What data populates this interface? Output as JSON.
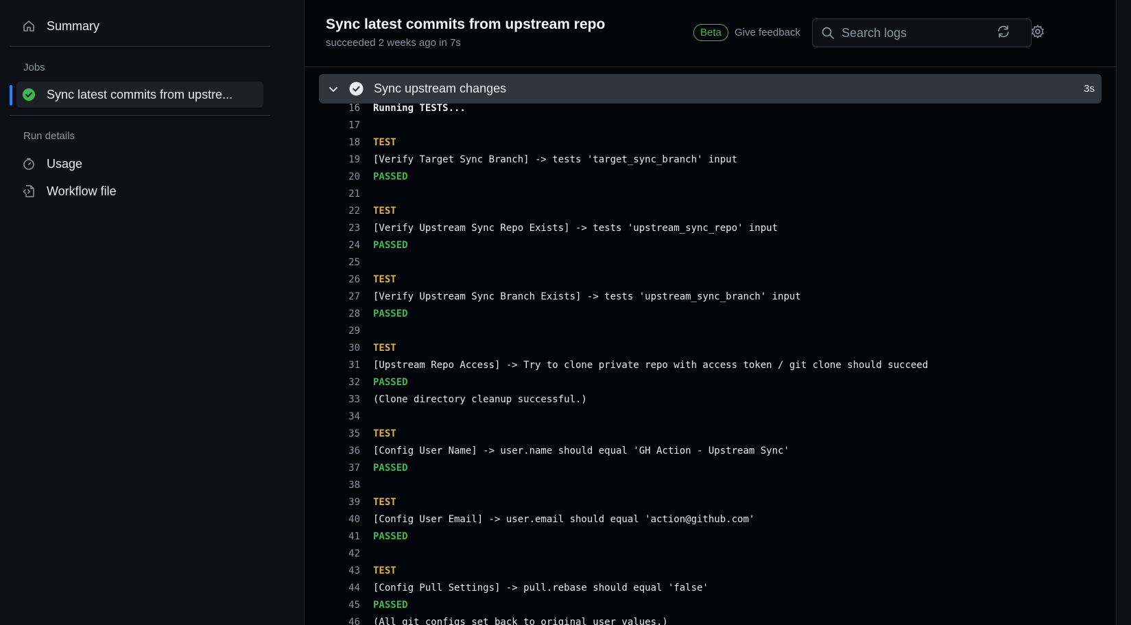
{
  "sidebar": {
    "summary_label": "Summary",
    "jobs_title": "Jobs",
    "job_label": "Sync latest commits from upstre...",
    "run_details_title": "Run details",
    "usage_label": "Usage",
    "workflow_label": "Workflow file"
  },
  "header": {
    "title": "Sync latest commits from upstream repo",
    "subtitle": "succeeded 2 weeks ago in 7s",
    "beta_label": "Beta",
    "feedback_label": "Give feedback",
    "search_placeholder": "Search logs"
  },
  "step": {
    "title": "Sync upstream changes",
    "duration": "3s"
  },
  "log_lines": [
    {
      "n": "16",
      "t": "Running TESTS...",
      "k": "info"
    },
    {
      "n": "17",
      "t": "",
      "k": ""
    },
    {
      "n": "18",
      "t": "TEST",
      "k": "test"
    },
    {
      "n": "19",
      "t": "[Verify Target Sync Branch] -> tests 'target_sync_branch' input",
      "k": ""
    },
    {
      "n": "20",
      "t": "PASSED",
      "k": "passed"
    },
    {
      "n": "21",
      "t": "",
      "k": ""
    },
    {
      "n": "22",
      "t": "TEST",
      "k": "test"
    },
    {
      "n": "23",
      "t": "[Verify Upstream Sync Repo Exists] -> tests 'upstream_sync_repo' input",
      "k": ""
    },
    {
      "n": "24",
      "t": "PASSED",
      "k": "passed"
    },
    {
      "n": "25",
      "t": "",
      "k": ""
    },
    {
      "n": "26",
      "t": "TEST",
      "k": "test"
    },
    {
      "n": "27",
      "t": "[Verify Upstream Sync Branch Exists] -> tests 'upstream_sync_branch' input",
      "k": ""
    },
    {
      "n": "28",
      "t": "PASSED",
      "k": "passed"
    },
    {
      "n": "29",
      "t": "",
      "k": ""
    },
    {
      "n": "30",
      "t": "TEST",
      "k": "test"
    },
    {
      "n": "31",
      "t": "[Upstream Repo Access] -> Try to clone private repo with access token / git clone should succeed",
      "k": ""
    },
    {
      "n": "32",
      "t": "PASSED",
      "k": "passed"
    },
    {
      "n": "33",
      "t": "(Clone directory cleanup successful.)",
      "k": ""
    },
    {
      "n": "34",
      "t": "",
      "k": ""
    },
    {
      "n": "35",
      "t": "TEST",
      "k": "test"
    },
    {
      "n": "36",
      "t": "[Config User Name] -> user.name should equal 'GH Action - Upstream Sync'",
      "k": ""
    },
    {
      "n": "37",
      "t": "PASSED",
      "k": "passed"
    },
    {
      "n": "38",
      "t": "",
      "k": ""
    },
    {
      "n": "39",
      "t": "TEST",
      "k": "test"
    },
    {
      "n": "40",
      "t": "[Config User Email] -> user.email should equal 'action@github.com'",
      "k": ""
    },
    {
      "n": "41",
      "t": "PASSED",
      "k": "passed"
    },
    {
      "n": "42",
      "t": "",
      "k": ""
    },
    {
      "n": "43",
      "t": "TEST",
      "k": "test"
    },
    {
      "n": "44",
      "t": "[Config Pull Settings] -> pull.rebase should equal 'false'",
      "k": ""
    },
    {
      "n": "45",
      "t": "PASSED",
      "k": "passed"
    },
    {
      "n": "46",
      "t": "(All git configs set back to original user values.)",
      "k": ""
    }
  ]
}
